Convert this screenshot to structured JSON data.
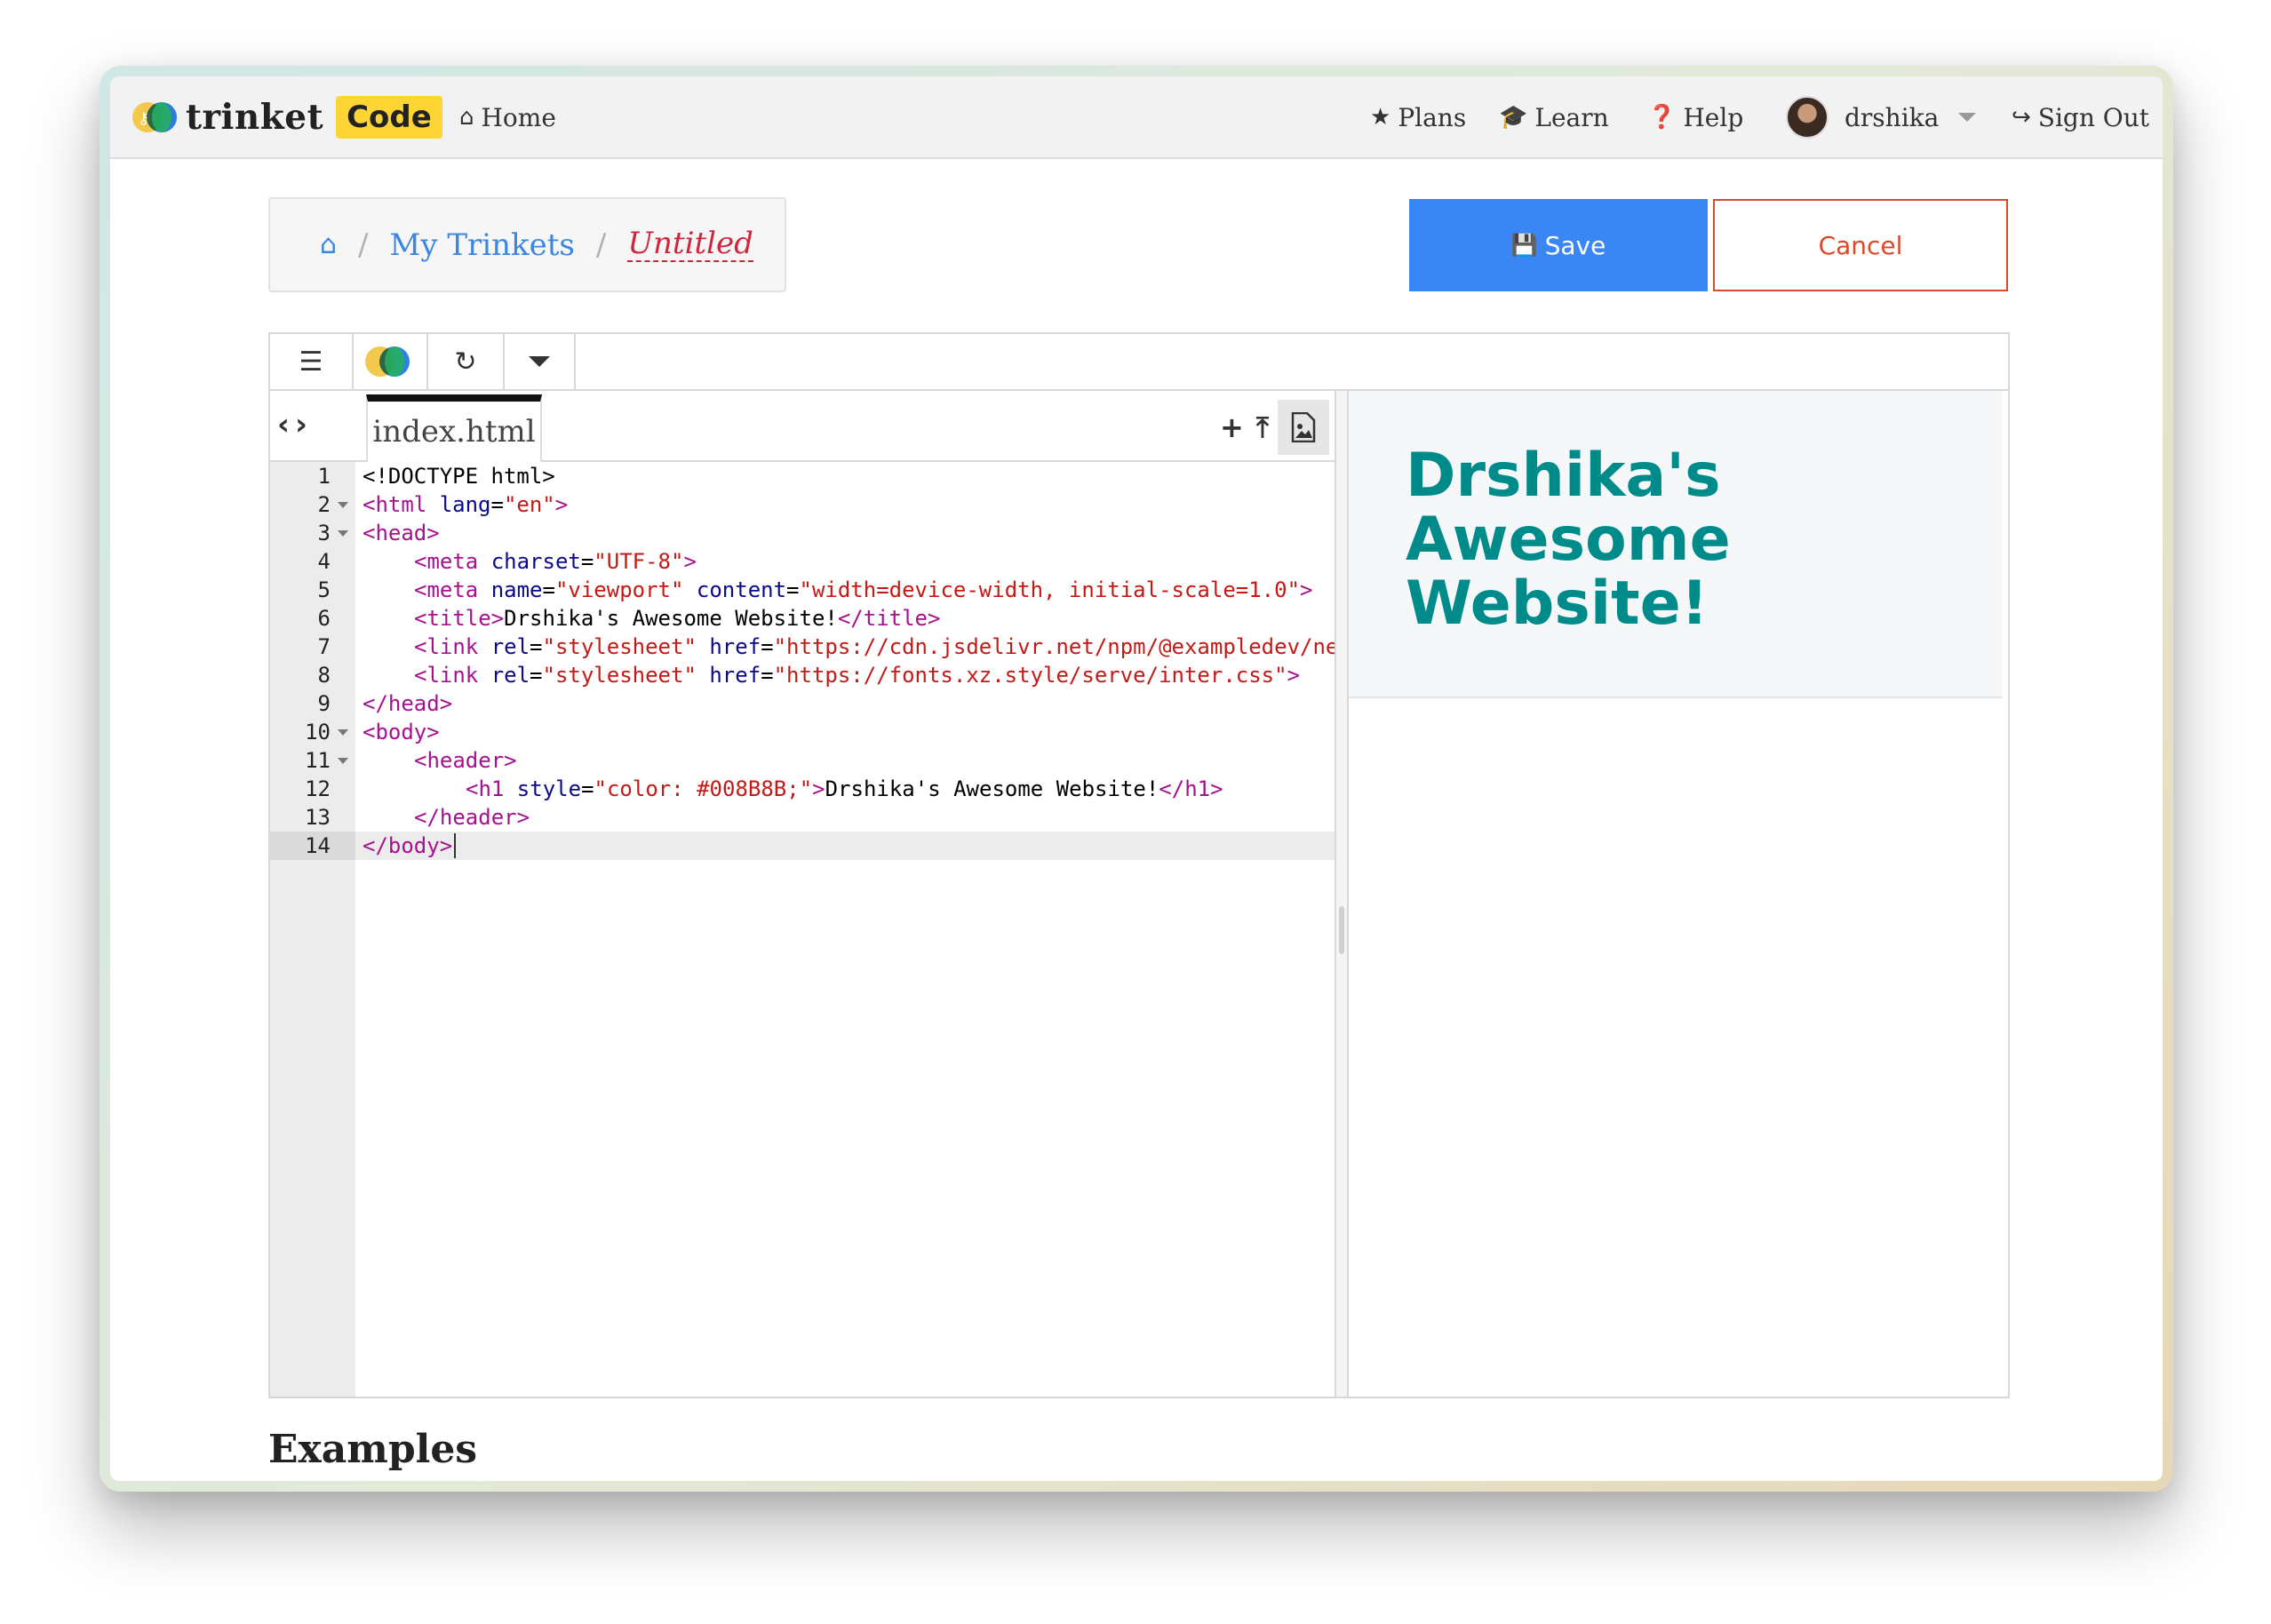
{
  "navbar": {
    "brand": "trinket",
    "brand_badge": "Code",
    "home": "Home",
    "plans": "Plans",
    "learn": "Learn",
    "help": "Help",
    "user": "drshika",
    "signout": "Sign Out"
  },
  "breadcrumb": {
    "my_trinkets": "My Trinkets",
    "current": "Untitled",
    "separator": "/"
  },
  "actions": {
    "save": "Save",
    "cancel": "Cancel"
  },
  "editor": {
    "file_tab": "index.html",
    "lines": [
      {
        "n": "1"
      },
      {
        "n": "2"
      },
      {
        "n": "3"
      },
      {
        "n": "4"
      },
      {
        "n": "5"
      },
      {
        "n": "6"
      },
      {
        "n": "7"
      },
      {
        "n": "8"
      },
      {
        "n": "9"
      },
      {
        "n": "10"
      },
      {
        "n": "11"
      },
      {
        "n": "12"
      },
      {
        "n": "13"
      },
      {
        "n": "14"
      }
    ],
    "code": {
      "l1": "<!DOCTYPE html>",
      "l2_tag": "<html",
      "l2_attr": " lang",
      "l2_eq": "=",
      "l2_val": "\"en\"",
      "l2_end": ">",
      "l3": "<head>",
      "l4_tag": "<meta",
      "l4_attr": " charset",
      "l4_val": "\"UTF-8\"",
      "l5_tag": "<meta",
      "l5_attr1": " name",
      "l5_val1": "\"viewport\"",
      "l5_attr2": " content",
      "l5_val2": "\"width=device-width, initial-scale=1.0\"",
      "l6_open": "<title>",
      "l6_text": "Drshika's Awesome Website!",
      "l6_close": "</title>",
      "l7_tag": "<link",
      "l7_attr1": " rel",
      "l7_val1": "\"stylesheet\"",
      "l7_attr2": " href",
      "l7_val2": "\"https://cdn.jsdelivr.net/npm/@exampledev/ne",
      "l8_tag": "<link",
      "l8_attr1": " rel",
      "l8_val1": "\"stylesheet\"",
      "l8_attr2": " href",
      "l8_val2": "\"https://fonts.xz.style/serve/inter.css\"",
      "l9": "</head>",
      "l10": "<body>",
      "l11": "<header>",
      "l12_tag": "<h1",
      "l12_attr": " style",
      "l12_val": "\"color: #008B8B;\"",
      "l12_text": "Drshika's Awesome Website!",
      "l12_close": "</h1>",
      "l13": "</header>",
      "l14": "</body>"
    }
  },
  "preview": {
    "heading": "Drshika's Awesome Website!",
    "heading_color": "#008B8B"
  },
  "section": {
    "examples": "Examples"
  },
  "colors": {
    "save_bg": "#3b86f5",
    "cancel": "#d84a2a",
    "link": "#3a86e0",
    "current_crumb": "#d0253d",
    "brand_badge": "#fcd535"
  },
  "icons": [
    "home-icon",
    "star-icon",
    "graduation-cap-icon",
    "question-circle-icon",
    "sign-out-icon",
    "save-icon",
    "menu-icon",
    "refresh-icon",
    "caret-down-icon",
    "chevron-left-icon",
    "chevron-right-icon",
    "plus-icon",
    "upload-icon",
    "image-file-icon"
  ]
}
